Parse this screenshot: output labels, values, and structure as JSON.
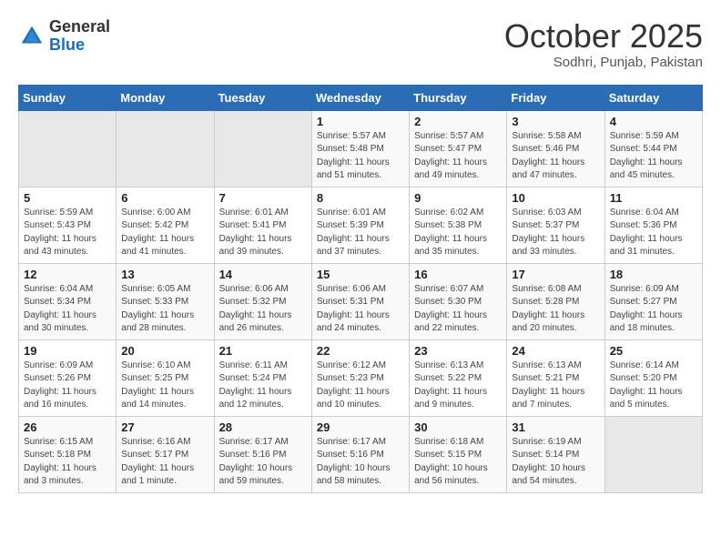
{
  "header": {
    "logo_line1": "General",
    "logo_line2": "Blue",
    "month_year": "October 2025",
    "location": "Sodhri, Punjab, Pakistan"
  },
  "days_of_week": [
    "Sunday",
    "Monday",
    "Tuesday",
    "Wednesday",
    "Thursday",
    "Friday",
    "Saturday"
  ],
  "weeks": [
    [
      {
        "day": "",
        "detail": ""
      },
      {
        "day": "",
        "detail": ""
      },
      {
        "day": "",
        "detail": ""
      },
      {
        "day": "1",
        "detail": "Sunrise: 5:57 AM\nSunset: 5:48 PM\nDaylight: 11 hours\nand 51 minutes."
      },
      {
        "day": "2",
        "detail": "Sunrise: 5:57 AM\nSunset: 5:47 PM\nDaylight: 11 hours\nand 49 minutes."
      },
      {
        "day": "3",
        "detail": "Sunrise: 5:58 AM\nSunset: 5:46 PM\nDaylight: 11 hours\nand 47 minutes."
      },
      {
        "day": "4",
        "detail": "Sunrise: 5:59 AM\nSunset: 5:44 PM\nDaylight: 11 hours\nand 45 minutes."
      }
    ],
    [
      {
        "day": "5",
        "detail": "Sunrise: 5:59 AM\nSunset: 5:43 PM\nDaylight: 11 hours\nand 43 minutes."
      },
      {
        "day": "6",
        "detail": "Sunrise: 6:00 AM\nSunset: 5:42 PM\nDaylight: 11 hours\nand 41 minutes."
      },
      {
        "day": "7",
        "detail": "Sunrise: 6:01 AM\nSunset: 5:41 PM\nDaylight: 11 hours\nand 39 minutes."
      },
      {
        "day": "8",
        "detail": "Sunrise: 6:01 AM\nSunset: 5:39 PM\nDaylight: 11 hours\nand 37 minutes."
      },
      {
        "day": "9",
        "detail": "Sunrise: 6:02 AM\nSunset: 5:38 PM\nDaylight: 11 hours\nand 35 minutes."
      },
      {
        "day": "10",
        "detail": "Sunrise: 6:03 AM\nSunset: 5:37 PM\nDaylight: 11 hours\nand 33 minutes."
      },
      {
        "day": "11",
        "detail": "Sunrise: 6:04 AM\nSunset: 5:36 PM\nDaylight: 11 hours\nand 31 minutes."
      }
    ],
    [
      {
        "day": "12",
        "detail": "Sunrise: 6:04 AM\nSunset: 5:34 PM\nDaylight: 11 hours\nand 30 minutes."
      },
      {
        "day": "13",
        "detail": "Sunrise: 6:05 AM\nSunset: 5:33 PM\nDaylight: 11 hours\nand 28 minutes."
      },
      {
        "day": "14",
        "detail": "Sunrise: 6:06 AM\nSunset: 5:32 PM\nDaylight: 11 hours\nand 26 minutes."
      },
      {
        "day": "15",
        "detail": "Sunrise: 6:06 AM\nSunset: 5:31 PM\nDaylight: 11 hours\nand 24 minutes."
      },
      {
        "day": "16",
        "detail": "Sunrise: 6:07 AM\nSunset: 5:30 PM\nDaylight: 11 hours\nand 22 minutes."
      },
      {
        "day": "17",
        "detail": "Sunrise: 6:08 AM\nSunset: 5:28 PM\nDaylight: 11 hours\nand 20 minutes."
      },
      {
        "day": "18",
        "detail": "Sunrise: 6:09 AM\nSunset: 5:27 PM\nDaylight: 11 hours\nand 18 minutes."
      }
    ],
    [
      {
        "day": "19",
        "detail": "Sunrise: 6:09 AM\nSunset: 5:26 PM\nDaylight: 11 hours\nand 16 minutes."
      },
      {
        "day": "20",
        "detail": "Sunrise: 6:10 AM\nSunset: 5:25 PM\nDaylight: 11 hours\nand 14 minutes."
      },
      {
        "day": "21",
        "detail": "Sunrise: 6:11 AM\nSunset: 5:24 PM\nDaylight: 11 hours\nand 12 minutes."
      },
      {
        "day": "22",
        "detail": "Sunrise: 6:12 AM\nSunset: 5:23 PM\nDaylight: 11 hours\nand 10 minutes."
      },
      {
        "day": "23",
        "detail": "Sunrise: 6:13 AM\nSunset: 5:22 PM\nDaylight: 11 hours\nand 9 minutes."
      },
      {
        "day": "24",
        "detail": "Sunrise: 6:13 AM\nSunset: 5:21 PM\nDaylight: 11 hours\nand 7 minutes."
      },
      {
        "day": "25",
        "detail": "Sunrise: 6:14 AM\nSunset: 5:20 PM\nDaylight: 11 hours\nand 5 minutes."
      }
    ],
    [
      {
        "day": "26",
        "detail": "Sunrise: 6:15 AM\nSunset: 5:18 PM\nDaylight: 11 hours\nand 3 minutes."
      },
      {
        "day": "27",
        "detail": "Sunrise: 6:16 AM\nSunset: 5:17 PM\nDaylight: 11 hours\nand 1 minute."
      },
      {
        "day": "28",
        "detail": "Sunrise: 6:17 AM\nSunset: 5:16 PM\nDaylight: 10 hours\nand 59 minutes."
      },
      {
        "day": "29",
        "detail": "Sunrise: 6:17 AM\nSunset: 5:16 PM\nDaylight: 10 hours\nand 58 minutes."
      },
      {
        "day": "30",
        "detail": "Sunrise: 6:18 AM\nSunset: 5:15 PM\nDaylight: 10 hours\nand 56 minutes."
      },
      {
        "day": "31",
        "detail": "Sunrise: 6:19 AM\nSunset: 5:14 PM\nDaylight: 10 hours\nand 54 minutes."
      },
      {
        "day": "",
        "detail": ""
      }
    ]
  ]
}
